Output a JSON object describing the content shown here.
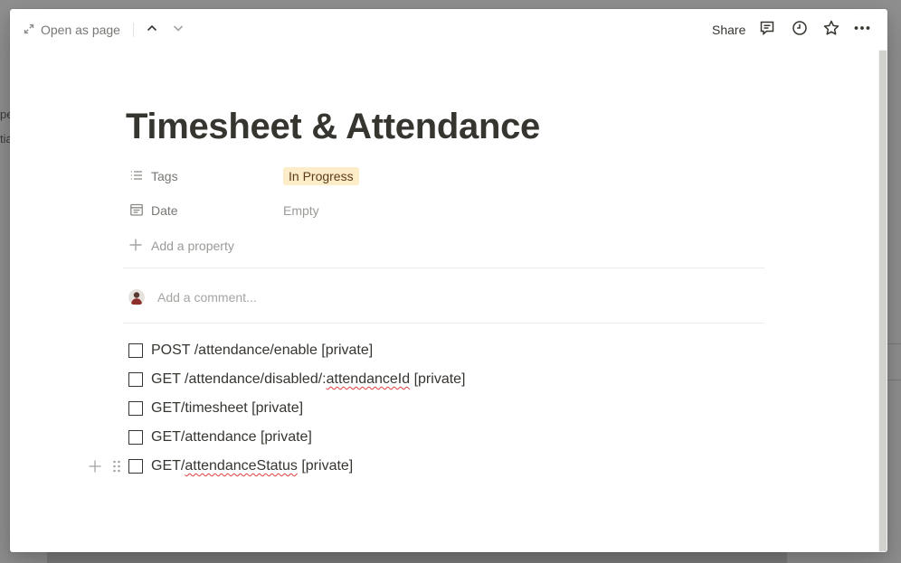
{
  "background": {
    "fragments": [
      "pe",
      "tia"
    ]
  },
  "topbar": {
    "open_as_page": "Open as page",
    "share": "Share"
  },
  "page": {
    "title": "Timesheet & Attendance",
    "properties": [
      {
        "name": "Tags",
        "icon": "list-icon",
        "value": "In Progress",
        "value_type": "tag",
        "tag_color": "#fdecc8"
      },
      {
        "name": "Date",
        "icon": "calendar-icon",
        "value": "Empty",
        "value_type": "empty"
      }
    ],
    "add_property": "Add a property",
    "comment_placeholder": "Add a comment...",
    "todos": [
      {
        "parts": [
          {
            "text": "POST /attendance/enable [private]",
            "spell": false
          }
        ],
        "checked": false
      },
      {
        "parts": [
          {
            "text": "GET /attendance/disabled/:",
            "spell": false
          },
          {
            "text": "attendanceId",
            "spell": true
          },
          {
            "text": " [private]",
            "spell": false
          }
        ],
        "checked": false
      },
      {
        "parts": [
          {
            "text": "GET/timesheet [private]",
            "spell": false
          }
        ],
        "checked": false
      },
      {
        "parts": [
          {
            "text": "GET/attendance [private]",
            "spell": false
          }
        ],
        "checked": false
      },
      {
        "parts": [
          {
            "text": "GET/",
            "spell": false
          },
          {
            "text": "attendanceStatus",
            "spell": true
          },
          {
            "text": " [private]",
            "spell": false
          }
        ],
        "checked": false
      }
    ]
  },
  "colors": {
    "text": "#37352f",
    "muted": "#787774",
    "placeholder": "#9b9a97",
    "tag_bg": "#fdecc8",
    "spellcheck": "#e03e3e"
  }
}
